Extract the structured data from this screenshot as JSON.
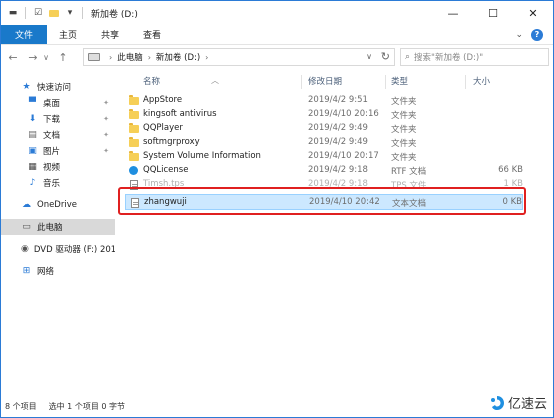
{
  "window": {
    "title": "新加卷 (D:)",
    "controls": {
      "minimize": "—",
      "maximize": "☐",
      "close": "✕"
    }
  },
  "ribbon": {
    "tabs": [
      "文件",
      "主页",
      "共享",
      "查看"
    ],
    "expand_glyph": "⌄",
    "help_glyph": "?"
  },
  "address": {
    "crumbs": [
      "此电脑",
      "新加卷 (D:)"
    ],
    "search_placeholder": "搜索\"新加卷 (D:)\""
  },
  "nav": {
    "items": [
      {
        "label": "快速访问",
        "icon": "star-icon",
        "pinned": false
      },
      {
        "label": "桌面",
        "icon": "desktop-icon",
        "pinned": true
      },
      {
        "label": "下载",
        "icon": "download-icon",
        "pinned": true
      },
      {
        "label": "文档",
        "icon": "document-icon",
        "pinned": true
      },
      {
        "label": "图片",
        "icon": "pictures-icon",
        "pinned": true
      },
      {
        "label": "视频",
        "icon": "video-icon",
        "pinned": false
      },
      {
        "label": "音乐",
        "icon": "music-icon",
        "pinned": false
      },
      {
        "label": "OneDrive",
        "icon": "cloud-icon",
        "pinned": false
      },
      {
        "label": "此电脑",
        "icon": "computer-icon",
        "pinned": false,
        "selected": true
      },
      {
        "label": "DVD 驱动器 (F:) 201",
        "icon": "dvd-icon",
        "pinned": false
      },
      {
        "label": "网络",
        "icon": "network-icon",
        "pinned": false
      }
    ]
  },
  "columns": {
    "name": "名称",
    "date": "修改日期",
    "type": "类型",
    "size": "大小"
  },
  "files": [
    {
      "name": "AppStore",
      "date": "2019/4/2 9:51",
      "type": "文件夹",
      "size": "",
      "kind": "folder"
    },
    {
      "name": "kingsoft antivirus",
      "date": "2019/4/10 20:16",
      "type": "文件夹",
      "size": "",
      "kind": "folder"
    },
    {
      "name": "QQPlayer",
      "date": "2019/4/2 9:49",
      "type": "文件夹",
      "size": "",
      "kind": "folder"
    },
    {
      "name": "softmgrproxy",
      "date": "2019/4/2 9:49",
      "type": "文件夹",
      "size": "",
      "kind": "folder"
    },
    {
      "name": "System Volume Information",
      "date": "2019/4/10 20:17",
      "type": "文件夹",
      "size": "",
      "kind": "folder"
    },
    {
      "name": "QQLicense",
      "date": "2019/4/2 9:18",
      "type": "RTF 文档",
      "size": "66 KB",
      "kind": "qq"
    },
    {
      "name": "Timsh.tps",
      "date": "2019/4/2 9:18",
      "type": "TPS 文件",
      "size": "1 KB",
      "kind": "doc"
    },
    {
      "name": "zhangwuji",
      "date": "2019/4/10 20:42",
      "type": "文本文档",
      "size": "0 KB",
      "kind": "doc"
    }
  ],
  "status": {
    "count": "8 个项目",
    "selection": "选中 1 个项目 0 字节"
  },
  "watermark": {
    "text": "亿速云",
    "color": "#1f8fe0"
  },
  "colors": {
    "accent": "#1979ca",
    "selection": "#cce8ff",
    "highlight_box": "#e02020"
  }
}
